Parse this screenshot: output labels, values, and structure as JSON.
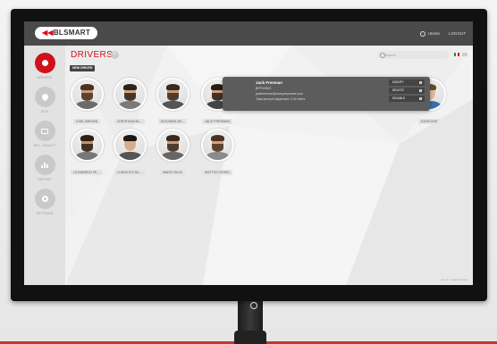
{
  "app": {
    "logo": "BLSMART",
    "user_label": "Utente",
    "logout_label": "LOGOUT"
  },
  "sidebar": {
    "items": [
      {
        "label": "DRIVERS",
        "icon": "user-icon",
        "active": true
      },
      {
        "label": "SITE",
        "icon": "location-pin-icon",
        "active": false
      },
      {
        "label": "SEL. SCANT?",
        "icon": "screen-icon",
        "active": false
      },
      {
        "label": "REPORT",
        "icon": "bar-chart-icon",
        "active": false
      },
      {
        "label": "SETTINGS",
        "icon": "gear-icon",
        "active": false
      }
    ]
  },
  "page": {
    "title": "DRIVERS",
    "count_badge": "+",
    "search_placeholder": "Search",
    "new_driver_label": "NEW DRIVER",
    "footer_note": "v1.1.0 · Posti 01 & bro"
  },
  "drivers": [
    {
      "name": "CARL BROWN",
      "skin": "#c89a78",
      "hair": "#4a3122",
      "shirt": "#6b6b6b",
      "beard": true
    },
    {
      "name": "CHRISTIAN BL...",
      "skin": "#d2a57f",
      "hair": "#2d2118",
      "shirt": "#7a7a7a",
      "beard": true
    },
    {
      "name": "GIOVANNI AR...",
      "skin": "#c69876",
      "hair": "#3b2a1d",
      "shirt": "#555555",
      "beard": true
    },
    {
      "name": "JACK FREEMAN",
      "skin": "#caa080",
      "hair": "#2a1d14",
      "shirt": "#444444",
      "beard": true
    },
    {
      "name": "JOHN DOE",
      "skin": "#e0b89a",
      "hair": "#6b4a2c",
      "shirt": "#3b6ea8",
      "beard": false
    },
    {
      "name": "LEONARDO FE...",
      "skin": "#c4936e",
      "hair": "#2c1f16",
      "shirt": "#777777",
      "beard": true
    },
    {
      "name": "LUDOVICO BL...",
      "skin": "#d8ad8b",
      "hair": "#1f1712",
      "shirt": "#555555",
      "beard": false
    },
    {
      "name": "MARIO SILIK",
      "skin": "#c79b78",
      "hair": "#3a2a1e",
      "shirt": "#666666",
      "beard": true
    },
    {
      "name": "MATTEO ROSSI",
      "skin": "#d1a37f",
      "hair": "#4b3323",
      "shirt": "#8a8a8a",
      "beard": true
    }
  ],
  "selected_driver": {
    "name": "Jack Freeman",
    "line1": "BPP4HB21",
    "line2": "jackfreeman@companyname.com",
    "line3": "Total amount dispensed: 0.00 Liters",
    "actions": [
      {
        "label": "MODIFY",
        "icon": "pencil-icon"
      },
      {
        "label": "DELETE",
        "icon": "trash-icon"
      },
      {
        "label": "DISABLE",
        "icon": "lock-icon"
      }
    ]
  },
  "colors": {
    "accent": "#d0111b",
    "topbar": "#4a4a4a"
  }
}
